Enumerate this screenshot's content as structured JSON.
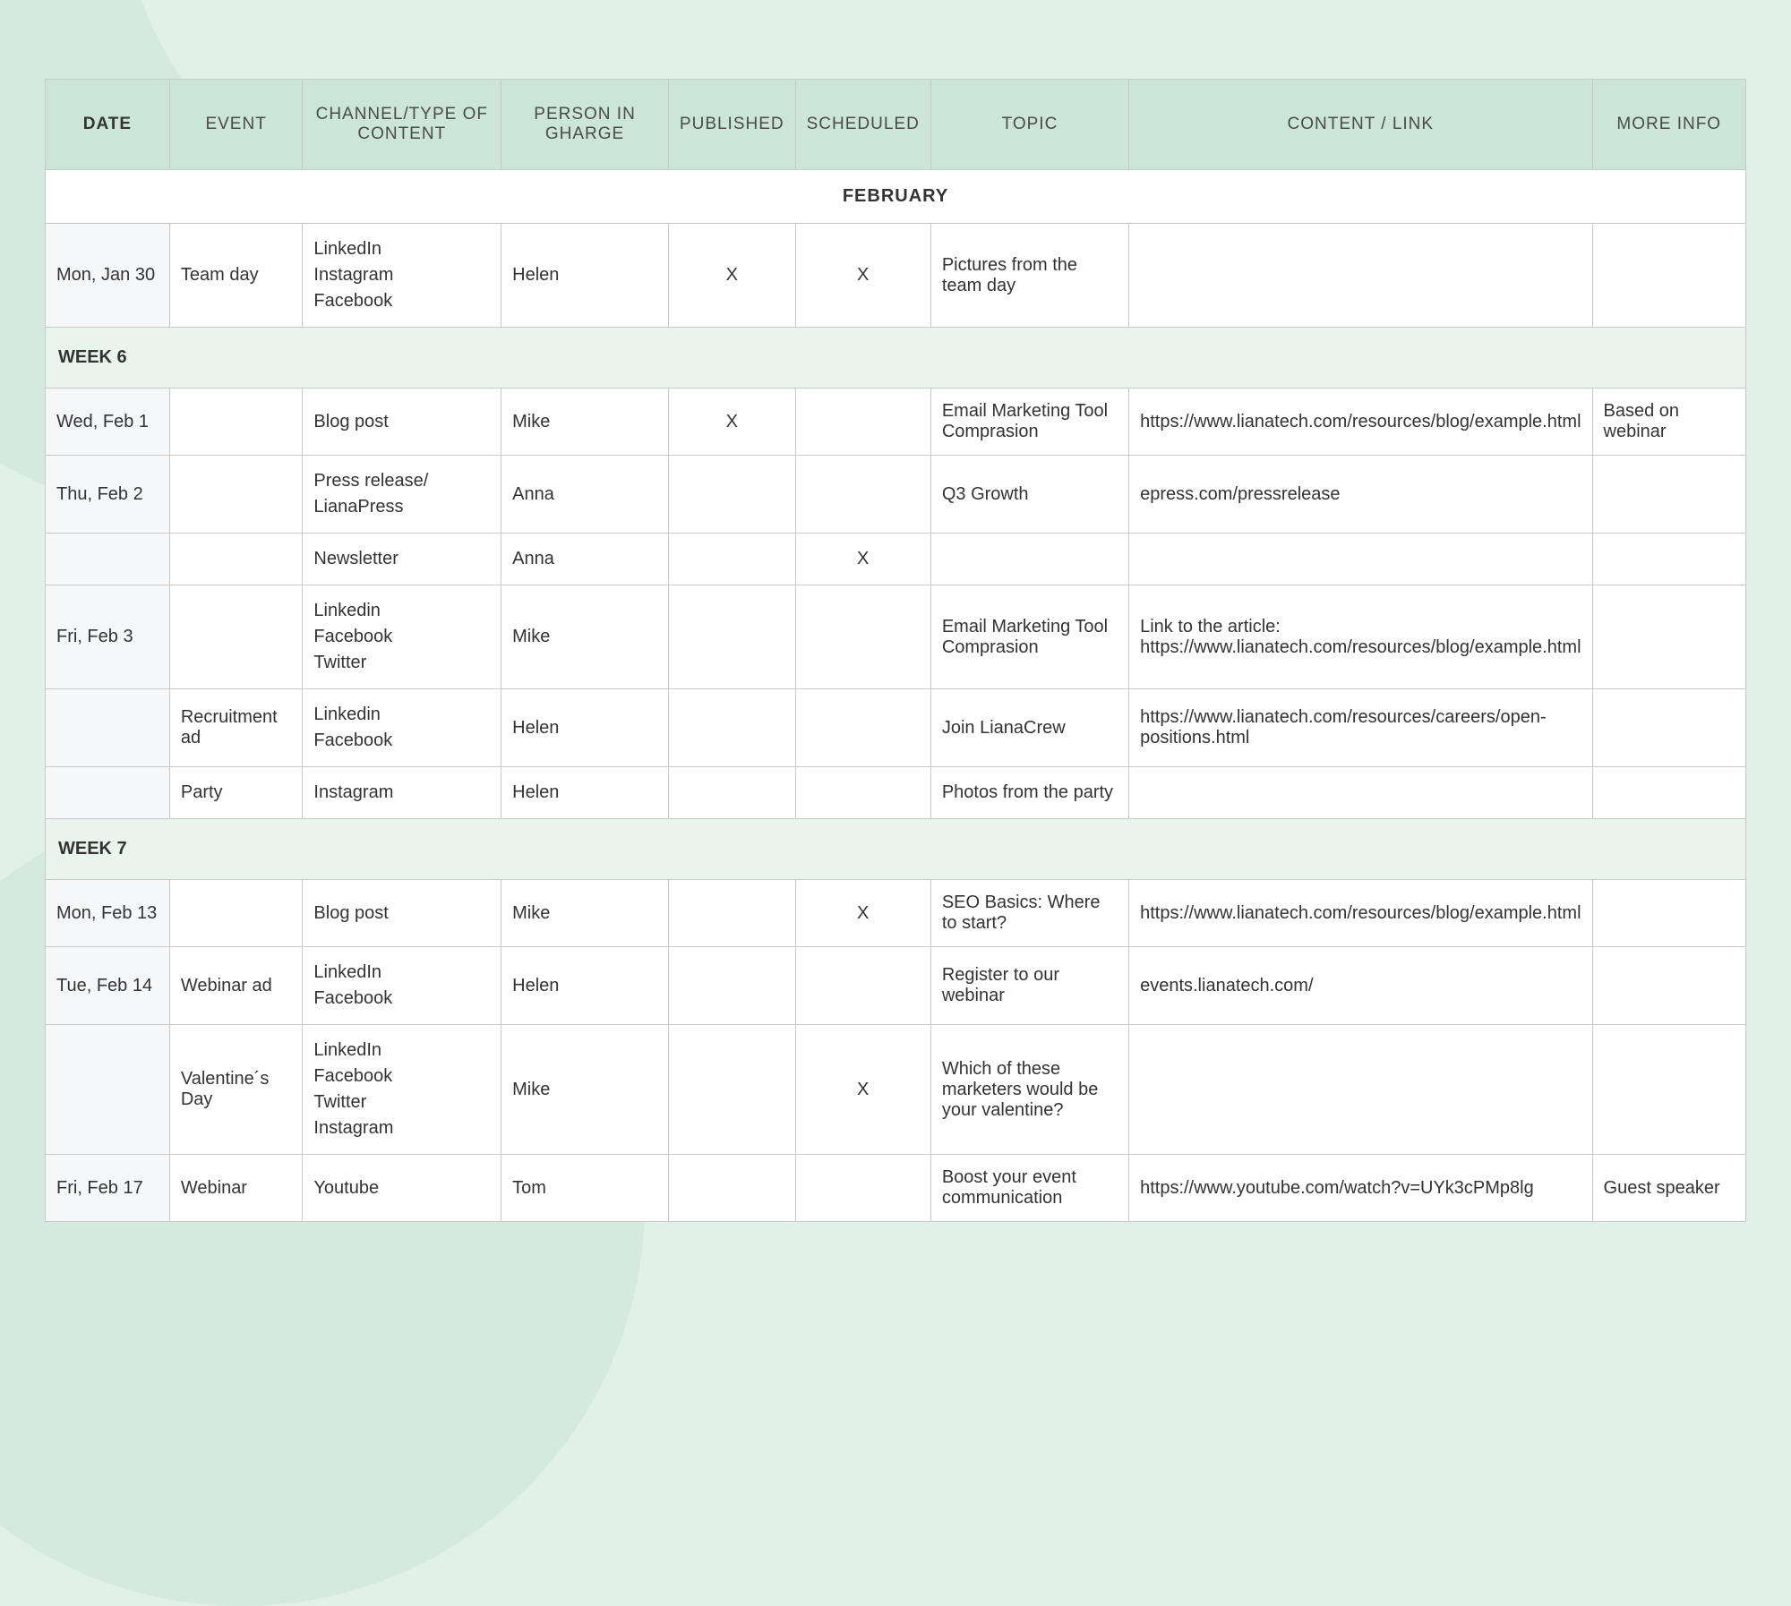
{
  "headers": {
    "date": "DATE",
    "event": "EVENT",
    "channel": "CHANNEL/TYPE OF CONTENT",
    "person": "PERSON IN GHARGE",
    "published": "PUBLISHED",
    "scheduled": "SCHEDULED",
    "topic": "TOPIC",
    "content": "CONTENT / LINK",
    "more": "MORE INFO"
  },
  "month": "FEBRUARY",
  "intro_row": {
    "date": "Mon, Jan 30",
    "event": "Team day",
    "channel": "LinkedIn\nInstagram\nFacebook",
    "person": "Helen",
    "published": "X",
    "scheduled": "X",
    "topic": "Pictures from the team day",
    "content": "",
    "more": ""
  },
  "week6_label": "WEEK 6",
  "week6": [
    {
      "date": "Wed, Feb 1",
      "event": "",
      "channel": "Blog post",
      "person": "Mike",
      "published": "X",
      "scheduled": "",
      "topic": "Email Marketing Tool Comprasion",
      "content": "https://www.lianatech.com/resources/blog/example.html",
      "more": "Based on webinar"
    },
    {
      "date": "Thu, Feb 2",
      "event": "",
      "channel": "Press release/\nLianaPress",
      "person": "Anna",
      "published": "",
      "scheduled": "",
      "topic": "Q3 Growth",
      "content": "epress.com/pressrelease",
      "more": ""
    },
    {
      "date": "",
      "event": "",
      "channel": "Newsletter",
      "person": "Anna",
      "published": "",
      "scheduled": "X",
      "topic": "",
      "content": "",
      "more": ""
    },
    {
      "date": "Fri, Feb 3",
      "event": "",
      "channel": "Linkedin\nFacebook\nTwitter",
      "person": "Mike",
      "published": "",
      "scheduled": "",
      "topic": "Email Marketing Tool Comprasion",
      "content": "Link to the article: https://www.lianatech.com/resources/blog/example.html",
      "more": ""
    },
    {
      "date": "",
      "event": "Recruitment ad",
      "channel": "Linkedin\nFacebook",
      "person": "Helen",
      "published": "",
      "scheduled": "",
      "topic": "Join LianaCrew",
      "content": "https://www.lianatech.com/resources/careers/open-positions.html",
      "more": ""
    },
    {
      "date": "",
      "event": "Party",
      "channel": "Instagram",
      "person": "Helen",
      "published": "",
      "scheduled": "",
      "topic": "Photos from the party",
      "content": "",
      "more": ""
    }
  ],
  "week7_label": "WEEK 7",
  "week7": [
    {
      "date": "Mon, Feb 13",
      "event": "",
      "channel": "Blog post",
      "person": "Mike",
      "published": "",
      "scheduled": "X",
      "topic": "SEO Basics: Where to start?",
      "content": "https://www.lianatech.com/resources/blog/example.html",
      "more": ""
    },
    {
      "date": "Tue, Feb 14",
      "event": "Webinar ad",
      "channel": "LinkedIn\nFacebook",
      "person": "Helen",
      "published": "",
      "scheduled": "",
      "topic": "Register to our webinar",
      "content": "events.lianatech.com/",
      "more": ""
    },
    {
      "date": "",
      "event": "Valentine´s Day",
      "channel": "LinkedIn\nFacebook\nTwitter\nInstagram",
      "person": "Mike",
      "published": "",
      "scheduled": "X",
      "topic": "Which of these marketers would be your valentine?",
      "content": "",
      "more": ""
    },
    {
      "date": "Fri, Feb 17",
      "event": "Webinar",
      "channel": "Youtube",
      "person": "Tom",
      "published": "",
      "scheduled": "",
      "topic": "Boost your event communication",
      "content": "https://www.youtube.com/watch?v=UYk3cPMp8lg",
      "more": "Guest speaker"
    }
  ]
}
